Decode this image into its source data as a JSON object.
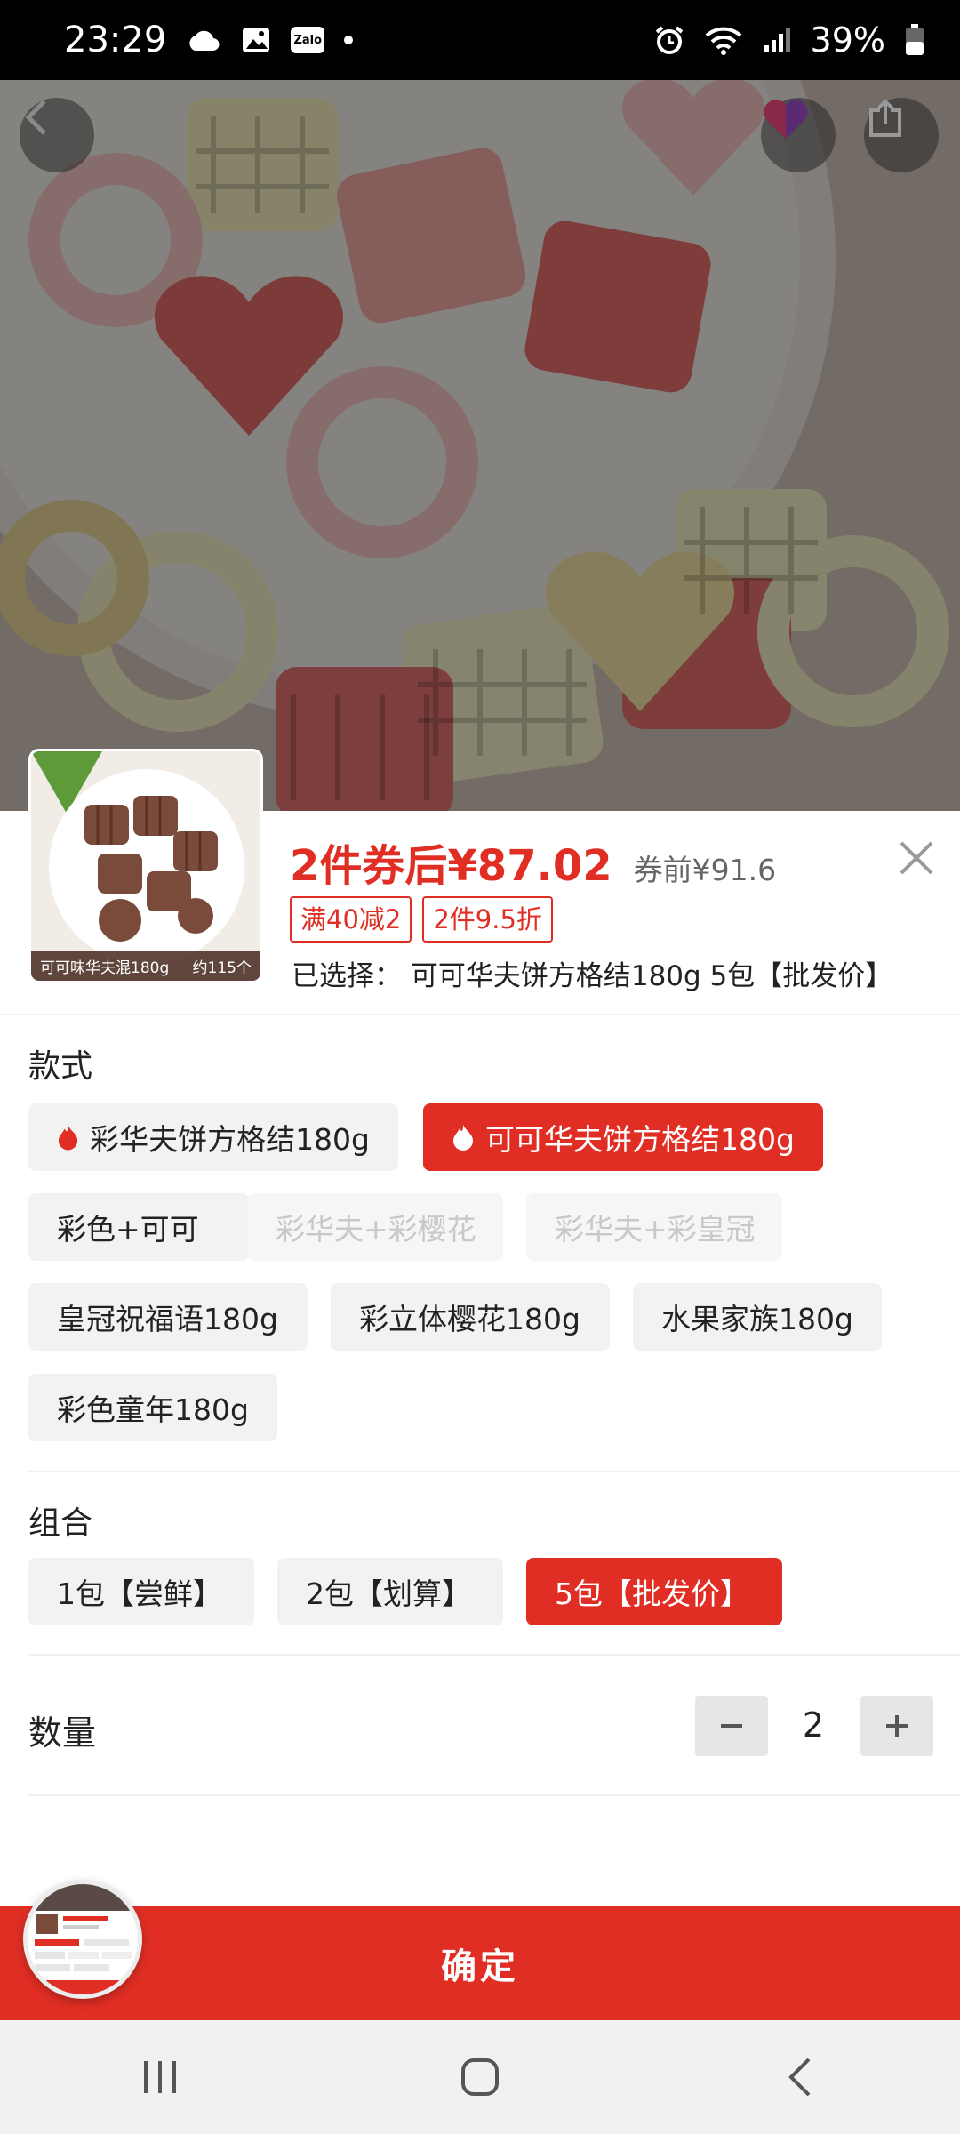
{
  "status_bar": {
    "time": "23:29",
    "zalo_label": "Zalo",
    "battery": "39%",
    "icons": [
      "cloud-icon",
      "gallery-icon",
      "zalo-icon",
      "dot-icon",
      "alarm-icon",
      "wifi-icon",
      "signal-icon",
      "battery-icon"
    ]
  },
  "product": {
    "thumb_caption_left": "可可味华夫混180g",
    "thumb_caption_right": "约115个",
    "price_label": "2件券后¥87.02",
    "price_before": "券前¥91.6",
    "promos": [
      "满40减2",
      "2件9.5折"
    ],
    "selected_text": "已选择：  可可华夫饼方格结180g 5包【批发价】"
  },
  "style_section": {
    "title": "款式",
    "options": [
      {
        "label": "彩华夫饼方格结180g",
        "state": "normal",
        "hot": true
      },
      {
        "label": "可可华夫饼方格结180g",
        "state": "selected",
        "hot": true
      },
      {
        "label": "彩色+可可",
        "state": "normal",
        "hot": false
      },
      {
        "label": "彩华夫+彩樱花",
        "state": "disabled",
        "hot": false
      },
      {
        "label": "彩华夫+彩皇冠",
        "state": "disabled",
        "hot": false
      },
      {
        "label": "皇冠祝福语180g",
        "state": "normal",
        "hot": false
      },
      {
        "label": "彩立体樱花180g",
        "state": "normal",
        "hot": false
      },
      {
        "label": "水果家族180g",
        "state": "normal",
        "hot": false
      },
      {
        "label": "彩色童年180g",
        "state": "normal",
        "hot": false
      }
    ]
  },
  "combo_section": {
    "title": "组合",
    "options": [
      {
        "label": "1包【尝鲜】",
        "state": "normal"
      },
      {
        "label": "2包【划算】",
        "state": "normal"
      },
      {
        "label": "5包【批发价】",
        "state": "selected"
      }
    ]
  },
  "quantity": {
    "label": "数量",
    "value": "2",
    "minus": "−",
    "plus": "+"
  },
  "confirm_label": "确定",
  "colors": {
    "accent": "#e02e24",
    "chip_bg": "#f2f2f2",
    "nav_bg": "#f1f1f1"
  }
}
